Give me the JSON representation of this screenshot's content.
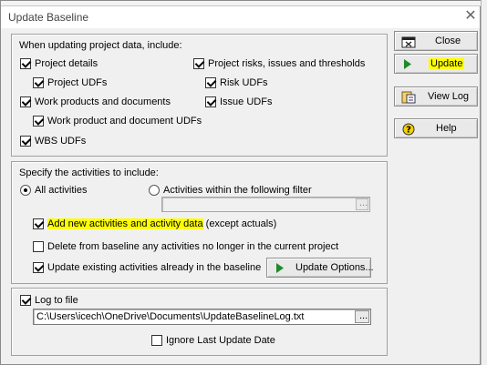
{
  "window": {
    "title": "Update Baseline",
    "close_glyph": "✕"
  },
  "update_section": {
    "heading": "When updating project data, include:",
    "options": {
      "project_details": {
        "label": "Project details",
        "checked": true
      },
      "project_udfs": {
        "label": "Project UDFs",
        "checked": true
      },
      "work_products": {
        "label": "Work products and documents",
        "checked": true
      },
      "work_product_udfs": {
        "label": "Work product and document UDFs",
        "checked": true
      },
      "wbs_udfs": {
        "label": "WBS UDFs",
        "checked": true
      },
      "risks_issues": {
        "label": "Project risks, issues and thresholds",
        "checked": true
      },
      "risk_udfs": {
        "label": "Risk UDFs",
        "checked": true
      },
      "issue_udfs": {
        "label": "Issue UDFs",
        "checked": true
      }
    }
  },
  "activities_section": {
    "heading": "Specify the activities to include:",
    "all_activities": {
      "label": "All activities",
      "selected": true
    },
    "filter_activities": {
      "label": "Activities within the following filter",
      "selected": false
    },
    "filter_value": "",
    "filter_button_label": "...",
    "add_new": {
      "label_highlighted": "Add new activities and activity data",
      "label_rest": " (except actuals)",
      "checked": true,
      "highlight_color": "#ffff00"
    },
    "delete_missing": {
      "label": "Delete from baseline any activities no longer in the current project",
      "checked": false
    },
    "update_existing": {
      "label": "Update existing activities already in the baseline",
      "checked": true
    },
    "update_options_label": "Update Options..."
  },
  "log_section": {
    "log_to_file": {
      "label": "Log to file",
      "checked": true
    },
    "log_path": "C:\\Users\\icech\\OneDrive\\Documents\\UpdateBaselineLog.txt",
    "browse_label": "..."
  },
  "ignore_last_update": {
    "label": "Ignore Last Update Date",
    "checked": false
  },
  "buttons": {
    "close": {
      "label": "Close",
      "icon": "close-window-icon"
    },
    "update": {
      "label": "Update",
      "icon": "play-arrow-icon",
      "highlighted": true
    },
    "view_log": {
      "label": "View Log",
      "icon": "view-log-icon"
    },
    "help": {
      "label": "Help",
      "icon": "help-icon"
    }
  },
  "colors": {
    "dialog_bg": "#f0f0f0",
    "play_green": "#1f8a2a",
    "highlight": "#ffff00"
  }
}
